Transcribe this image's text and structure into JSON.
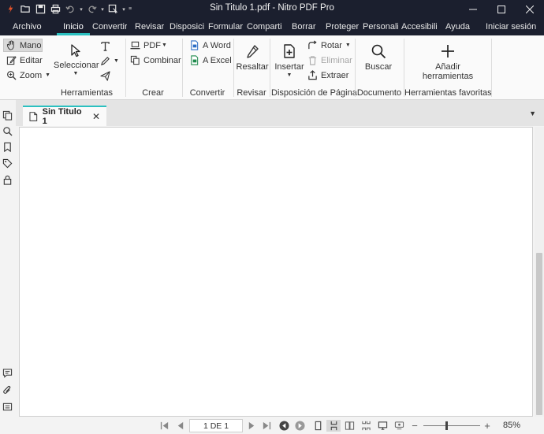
{
  "window": {
    "title": "Sin Titulo 1.pdf - Nitro PDF Pro"
  },
  "menu": {
    "tabs": [
      "Archivo",
      "Inicio",
      "Convertir",
      "Revisar",
      "Disposició",
      "Formulari",
      "Comparti",
      "Borrar",
      "Proteger",
      "Personaliz",
      "Accesibilic",
      "Ayuda"
    ],
    "active": "Inicio",
    "signin": "Iniciar sesión"
  },
  "ribbon": {
    "herramientas": {
      "mano": "Mano",
      "editar": "Editar",
      "zoom": "Zoom",
      "seleccionar": "Seleccionar",
      "group": "Herramientas"
    },
    "crear": {
      "pdf": "PDF",
      "combinar": "Combinar",
      "group": "Crear"
    },
    "convertir": {
      "word": "A Word",
      "excel": "A Excel",
      "group": "Convertir"
    },
    "revisar": {
      "resaltar": "Resaltar",
      "group": "Revisar"
    },
    "disposicion": {
      "insertar": "Insertar",
      "rotar": "Rotar",
      "eliminar": "Eliminar",
      "extraer": "Extraer",
      "group": "Disposición de Página"
    },
    "documento": {
      "buscar": "Buscar",
      "group": "Documento"
    },
    "favoritas": {
      "add_line1": "Añadir",
      "add_line2": "herramientas",
      "group": "Herramientas favoritas"
    }
  },
  "document": {
    "tab_name": "Sin Titulo 1"
  },
  "status": {
    "page": "1 DE 1",
    "zoom": "85%",
    "zoom_level": 0.4
  },
  "colors": {
    "titlebar": "#1b1f2e",
    "accent": "#2bc0c0"
  }
}
